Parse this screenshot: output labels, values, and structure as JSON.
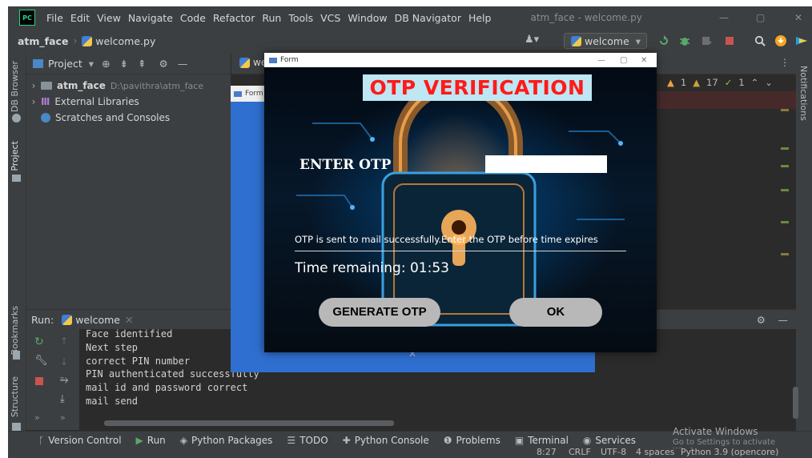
{
  "menubar": {
    "items": [
      "File",
      "Edit",
      "View",
      "Navigate",
      "Code",
      "Refactor",
      "Run",
      "Tools",
      "VCS",
      "Window",
      "DB Navigator",
      "Help"
    ],
    "window_title": "atm_face - welcome.py"
  },
  "navbar": {
    "project": "atm_face",
    "file": "welcome.py",
    "run_config": "welcome"
  },
  "project_panel": {
    "title": "Project",
    "tree": [
      {
        "name": "atm_face",
        "path": "D:\\pavithra\\atm_face"
      },
      {
        "name": "External Libraries",
        "path": ""
      },
      {
        "name": "Scratches and Consoles",
        "path": ""
      }
    ]
  },
  "editor": {
    "tab": "wel",
    "inspection": {
      "warnings": "1",
      "weak_warnings": "17",
      "ok": "1"
    }
  },
  "left_tabs": [
    "DB Browser",
    "Project",
    "Bookmarks",
    "Structure"
  ],
  "right_tabs": [
    "Notifications"
  ],
  "run_panel": {
    "label": "Run:",
    "tab": "welcome",
    "console": [
      "Face identified",
      "Next step",
      "correct PIN number",
      "PIN authenticated successfully",
      "mail id and password correct",
      "mail send"
    ]
  },
  "bottom_tabs": [
    "Version Control",
    "Run",
    "Python Packages",
    "TODO",
    "Python Console",
    "Problems",
    "Terminal",
    "Services"
  ],
  "activate": {
    "title": "Activate Windows",
    "subtitle": "Go to Settings to activate Windows."
  },
  "statusbar": {
    "position": "8:27",
    "line_sep": "CRLF",
    "encoding": "UTF-8",
    "indent": "4 spaces",
    "interpreter": "Python 3.9 (opencore)"
  },
  "bg_form": {
    "title": "Form"
  },
  "otp_window": {
    "title": "Form",
    "heading": "OTP VERIFICATION",
    "enter_label": "ENTER OTP",
    "input_value": "",
    "message": "OTP is sent to mail successfully.Enter the OTP before time expires",
    "timer": "Time remaining: 01:53",
    "generate_button": "GENERATE OTP",
    "ok_button": "OK"
  },
  "colors": {
    "ide_bg": "#2b2b2b",
    "panel_bg": "#3c3f41",
    "title_red": "#ff1a1a",
    "title_bg": "#bfe6f3",
    "button_gray": "#b8b8b8"
  }
}
